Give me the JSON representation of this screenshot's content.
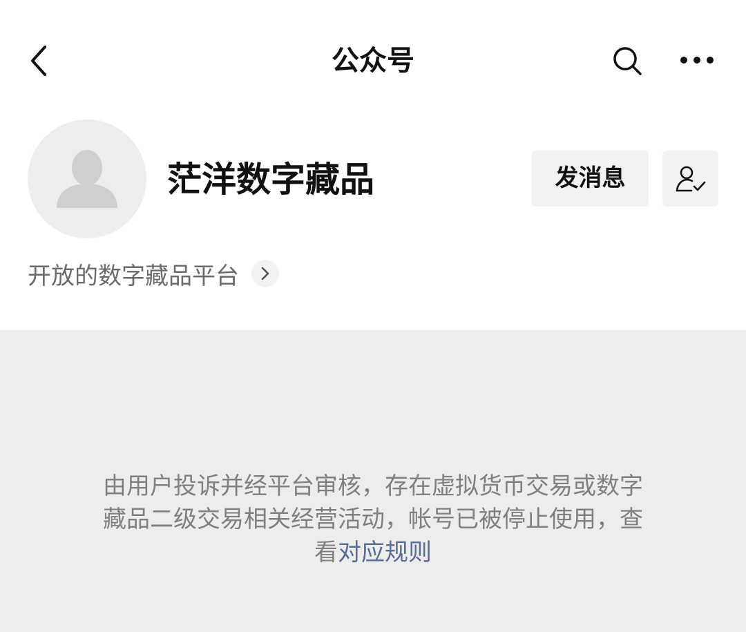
{
  "navbar": {
    "title": "公众号",
    "back_icon": "chevron-left-icon",
    "search_icon": "search-icon",
    "more_icon": "more-dots-icon"
  },
  "profile": {
    "avatar_icon": "default-avatar-icon",
    "name": "茫洋数字藏品",
    "message_button": "发消息",
    "follow_icon": "user-check-icon",
    "description": "开放的数字藏品平台",
    "description_arrow_icon": "chevron-right-icon"
  },
  "notice": {
    "line1": "由用户投诉并经平台审核，存在虚拟货币交易或数字",
    "line2": "藏品二级交易相关经营活动，帐号已被停止使用，查",
    "line3_prefix": "看",
    "link": "对应规则"
  },
  "colors": {
    "background": "#ffffff",
    "notice_background": "#ededed",
    "button_background": "#f2f2f2",
    "link": "#576b95",
    "muted_text": "#808080"
  }
}
